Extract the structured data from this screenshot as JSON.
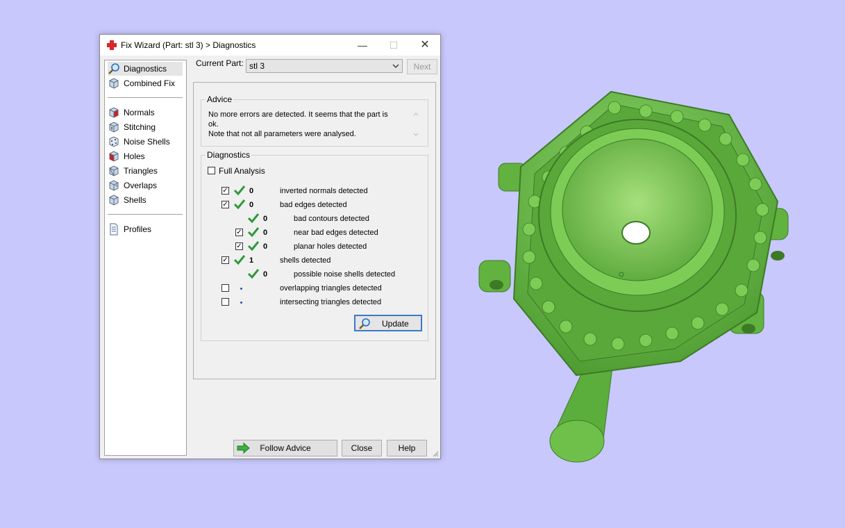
{
  "window": {
    "title": "Fix Wizard (Part: stl 3) > Diagnostics",
    "minimize": "—",
    "maximize": "☐",
    "close": "✕"
  },
  "sidebar": {
    "items": [
      {
        "label": "Diagnostics",
        "icon": "magnifier-icon"
      },
      {
        "label": "Combined Fix",
        "icon": "cube-icon"
      },
      {
        "label": "Normals",
        "icon": "normals-cube-icon"
      },
      {
        "label": "Stitching",
        "icon": "stitching-cube-icon"
      },
      {
        "label": "Noise Shells",
        "icon": "noise-shells-icon"
      },
      {
        "label": "Holes",
        "icon": "holes-cube-icon"
      },
      {
        "label": "Triangles",
        "icon": "triangles-cube-icon"
      },
      {
        "label": "Overlaps",
        "icon": "overlaps-cube-icon"
      },
      {
        "label": "Shells",
        "icon": "shells-cube-icon"
      },
      {
        "label": "Profiles",
        "icon": "document-icon"
      }
    ]
  },
  "current_part": {
    "label": "Current Part:",
    "value": "stl 3",
    "next_label": "Next"
  },
  "advice": {
    "title": "Advice",
    "line1": "No more errors are detected. It seems that the part is ok.",
    "line2": "Note that not all parameters were analysed."
  },
  "diagnostics": {
    "title": "Diagnostics",
    "full_analysis": "Full Analysis",
    "rows": [
      {
        "count": "0",
        "label": "inverted normals detected"
      },
      {
        "count": "0",
        "label": "bad edges detected"
      },
      {
        "count": "0",
        "label": "bad contours detected"
      },
      {
        "count": "0",
        "label": "near bad edges detected"
      },
      {
        "count": "0",
        "label": "planar holes detected"
      },
      {
        "count": "1",
        "label": "shells detected"
      },
      {
        "count": "0",
        "label": "possible noise shells detected"
      },
      {
        "count": "",
        "label": "overlapping triangles detected"
      },
      {
        "count": "",
        "label": "intersecting triangles detected"
      }
    ],
    "update_label": "Update"
  },
  "buttons": {
    "follow_advice": "Follow Advice",
    "close": "Close",
    "help": "Help"
  },
  "colors": {
    "background": "#c8c8fd",
    "model_green": "#6fc04a",
    "check_green": "#2e9a3a",
    "focus_blue": "#3a78c8"
  }
}
